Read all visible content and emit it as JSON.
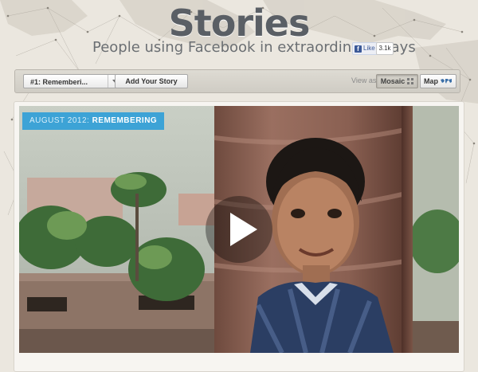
{
  "header": {
    "title": "Stories",
    "subtitle": "People using Facebook in extraordinary ways",
    "like_label": "Like",
    "like_count": "3.1k"
  },
  "toolbar": {
    "story_select": "#1: Rememberi...",
    "add_story_label": "Add Your Story",
    "view_as_label": "View as",
    "mosaic_label": "Mosaic",
    "map_label": "Map"
  },
  "story": {
    "badge_date": "AUGUST 2012:",
    "badge_title": "REMEMBERING"
  },
  "colors": {
    "accent": "#3da3d6",
    "background": "#ebe7df"
  },
  "icons": [
    "facebook-icon",
    "grid-icon",
    "world-map-icon",
    "play-icon",
    "chevron-down-icon"
  ]
}
